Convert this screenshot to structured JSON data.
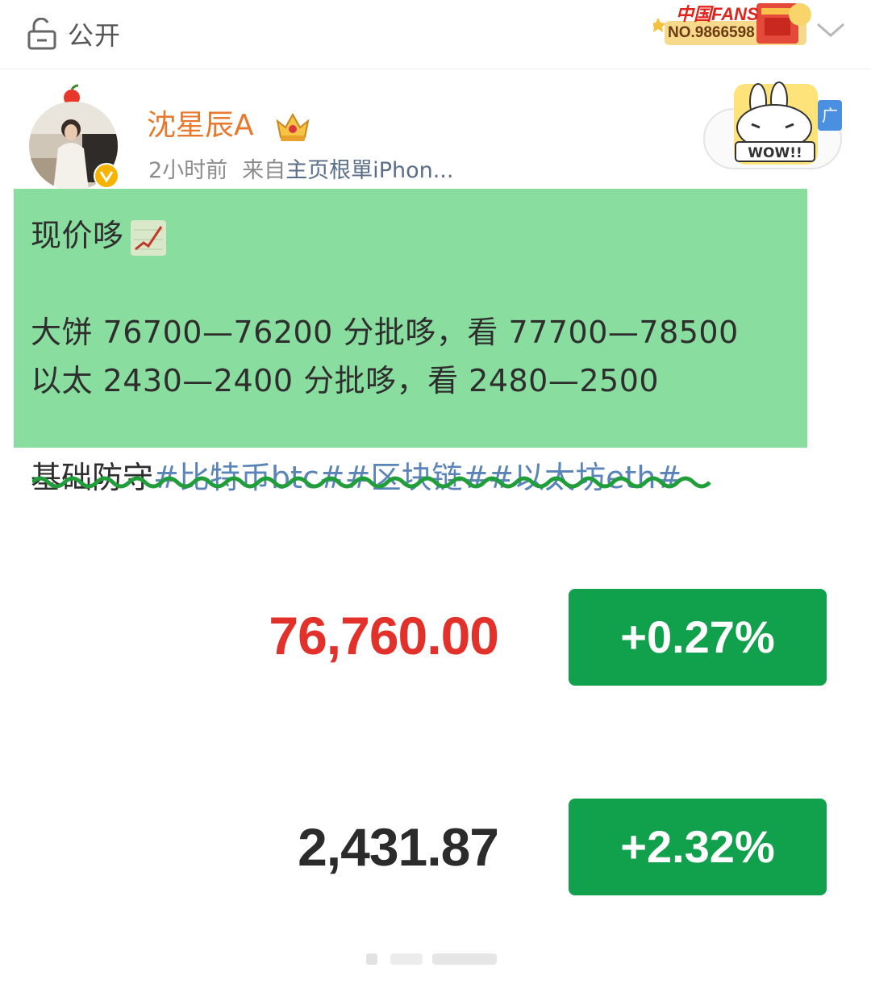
{
  "visibility": {
    "label": "公开",
    "icon": "unlock-icon"
  },
  "fans_badge": {
    "title": "中国FANS",
    "number": "NO.9866598"
  },
  "post": {
    "author": "沈星辰A",
    "time": "2小时前",
    "source_prefix": "来自",
    "source": "主页根單iPhon...",
    "ad_tag": "广",
    "ad_sticker_text": "WOW!!",
    "lines": [
      "现价哆",
      "大饼 76700—76200 分批哆，看 77700—78500",
      "以太 2430—2400 分批哆，看 2480—2500"
    ],
    "footer_text": "基础防守",
    "hashtags": [
      "#比特币btc#",
      "#区块链#",
      "#以太坊eth#"
    ]
  },
  "quotes": [
    {
      "price": "76,760.00",
      "change": "+0.27%",
      "price_color": "#e2312b"
    },
    {
      "price": "2,431.87",
      "change": "+2.32%",
      "price_color": "#2b2b2b"
    }
  ],
  "colors": {
    "highlight": "#89de9f",
    "username": "#e8782c",
    "change_button": "#11a04b",
    "hashtag": "#5a84b8"
  }
}
